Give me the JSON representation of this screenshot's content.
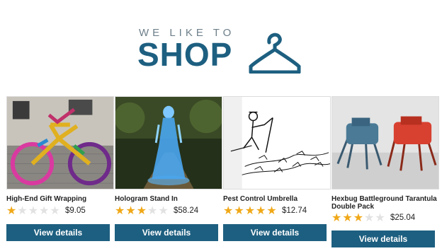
{
  "logo": {
    "tagline": "WE LIKE TO",
    "word": "SHOP",
    "brand_color": "#1d5f80",
    "tagline_color": "#6d7f8a",
    "icon": "hanger-icon"
  },
  "colors": {
    "button": "#1d5f80",
    "star_on": "#f0a818",
    "star_off": "#e2e2e2"
  },
  "products": [
    {
      "title": "High-End Gift Wrapping",
      "rating": 1,
      "max_rating": 5,
      "price": "$9.05",
      "button_label": "View details",
      "image": "yarn-bombed-bicycle"
    },
    {
      "title": "Hologram Stand In",
      "rating": 3,
      "max_rating": 5,
      "price": "$58.24",
      "button_label": "View details",
      "image": "blue-hologram-woman"
    },
    {
      "title": "Pest Control Umbrella",
      "rating": 5,
      "max_rating": 5,
      "price": "$12.74",
      "button_label": "View details",
      "image": "umbrella-sketch"
    },
    {
      "title": "Hexbug Battleground Tarantula Double Pack",
      "rating": 3,
      "max_rating": 5,
      "price": "$25.04",
      "button_label": "View details",
      "image": "robot-spiders"
    }
  ]
}
